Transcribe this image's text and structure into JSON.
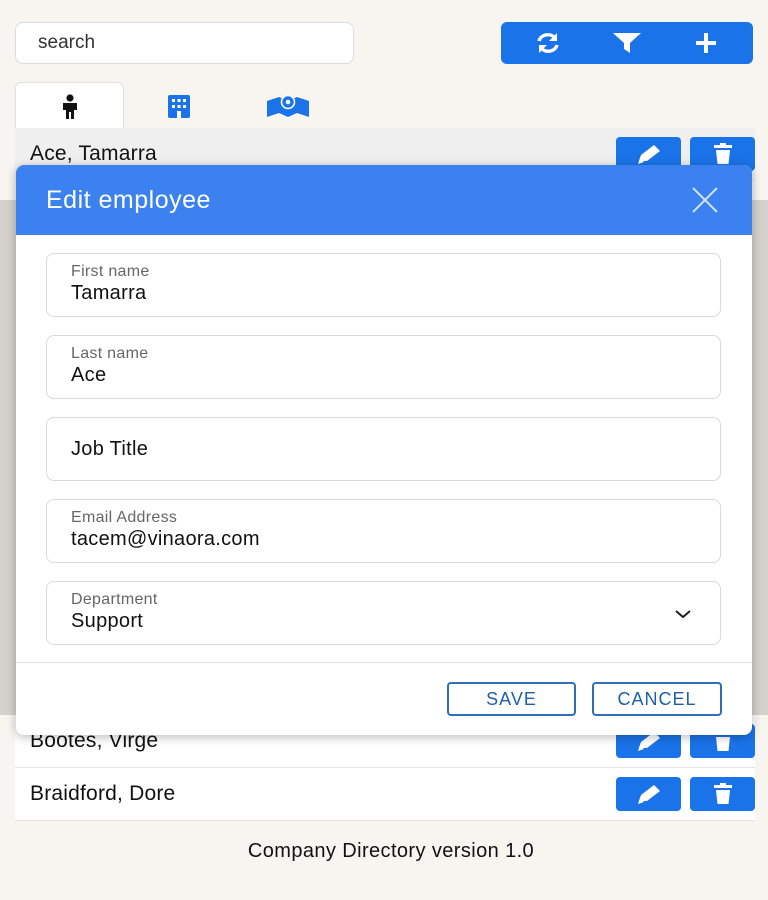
{
  "search": {
    "placeholder": "search"
  },
  "toolbar": {
    "icons": [
      "refresh-icon",
      "filter-icon",
      "plus-icon"
    ]
  },
  "tabs": [
    {
      "icon": "person-icon",
      "active": true
    },
    {
      "icon": "building-icon",
      "active": false
    },
    {
      "icon": "map-icon",
      "active": false
    }
  ],
  "employees": [
    {
      "name": "Ace, Tamarra"
    },
    {
      "name": "Bootes, Virge"
    },
    {
      "name": "Braidford, Dore"
    }
  ],
  "modal": {
    "title": "Edit employee",
    "fields": {
      "first_name": {
        "label": "First name",
        "value": "Tamarra"
      },
      "last_name": {
        "label": "Last name",
        "value": "Ace"
      },
      "job_title": {
        "placeholder": "Job Title",
        "value": ""
      },
      "email": {
        "label": "Email Address",
        "value": "tacem@vinaora.com"
      },
      "department": {
        "label": "Department",
        "value": "Support"
      }
    },
    "save_label": "SAVE",
    "cancel_label": "CANCEL"
  },
  "footer": {
    "text": "Company Directory version 1.0"
  },
  "colors": {
    "primary": "#1a73e8",
    "modal_header": "#3b82f0",
    "background": "#f8f4ef"
  }
}
